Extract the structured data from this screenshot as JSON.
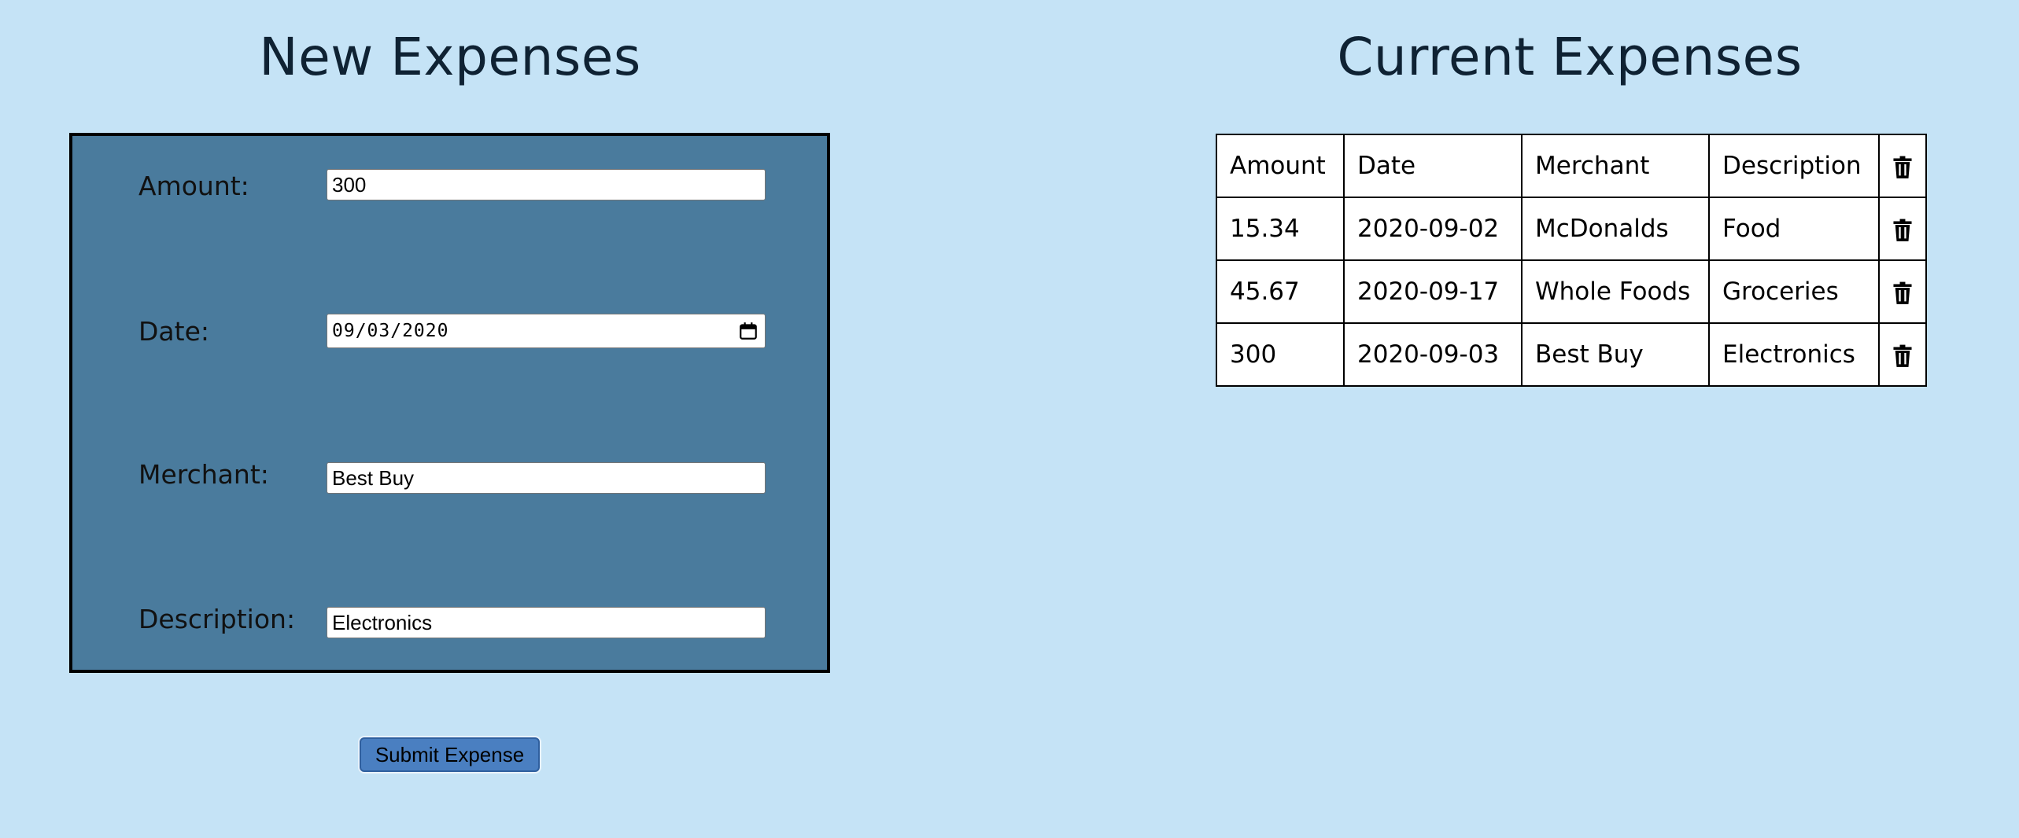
{
  "form": {
    "title": "New Expenses",
    "fields": {
      "amount": {
        "label": "Amount:",
        "value": "300"
      },
      "date": {
        "label": "Date:",
        "value": "09/03/2020"
      },
      "merchant": {
        "label": "Merchant:",
        "value": "Best Buy"
      },
      "description": {
        "label": "Description:",
        "value": "Electronics"
      }
    },
    "submit_label": "Submit Expense"
  },
  "table": {
    "title": "Current Expenses",
    "headers": [
      "Amount",
      "Date",
      "Merchant",
      "Description"
    ],
    "delete_icon": "trash-icon",
    "rows": [
      [
        "15.34",
        "2020-09-02",
        "McDonalds",
        "Food"
      ],
      [
        "45.67",
        "2020-09-17",
        "Whole Foods",
        "Groceries"
      ],
      [
        "300",
        "2020-09-03",
        "Best Buy",
        "Electronics"
      ]
    ]
  },
  "colors": {
    "background": "#c5e3f6",
    "form_panel": "#4a7b9d",
    "submit_button": "#4a7fc1",
    "heading_text": "#0f2233"
  }
}
